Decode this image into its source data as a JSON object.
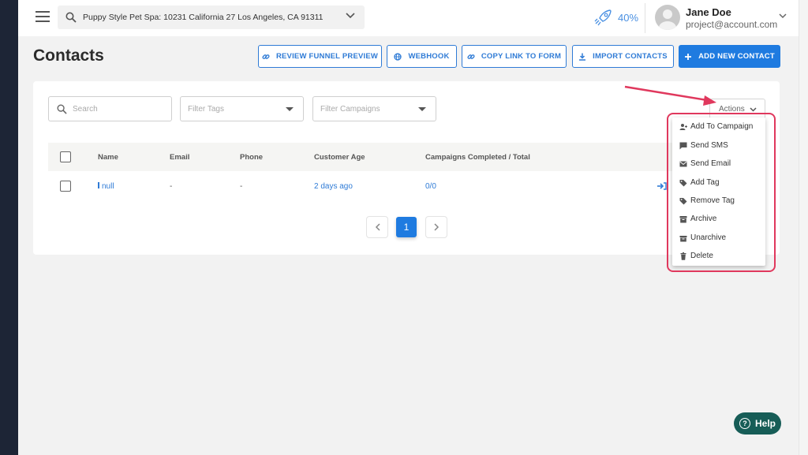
{
  "header": {
    "location": "Puppy Style Pet Spa: 10231 California 27 Los Angeles, CA 91311",
    "progress": "40%",
    "user_name": "Jane Doe",
    "user_email": "project@account.com"
  },
  "page": {
    "title": "Contacts"
  },
  "toolbar": {
    "review_funnel": "REVIEW FUNNEL PREVIEW",
    "webhook": "WEBHOOK",
    "copy_link": "COPY LINK TO FORM",
    "import_contacts": "IMPORT CONTACTS",
    "add_contact": "ADD NEW CONTACT"
  },
  "filters": {
    "search_placeholder": "Search",
    "tags_placeholder": "Filter Tags",
    "campaigns_placeholder": "Filter Campaigns",
    "actions_label": "Actions"
  },
  "table": {
    "columns": [
      "Name",
      "Email",
      "Phone",
      "Customer Age",
      "Campaigns Completed / Total"
    ],
    "rows": [
      {
        "name": "null",
        "email": "-",
        "phone": "-",
        "customer_age": "2 days ago",
        "campaigns": "0/0"
      }
    ]
  },
  "pagination": {
    "current": "1"
  },
  "actions_menu": {
    "items": [
      "Add To Campaign",
      "Send SMS",
      "Send Email",
      "Add Tag",
      "Remove Tag",
      "Archive",
      "Unarchive",
      "Delete"
    ]
  },
  "help": {
    "label": "Help"
  },
  "colors": {
    "primary": "#1f7be0",
    "highlight": "#e0385d",
    "help_bg": "#175d57",
    "sidebar": "#1d2536"
  }
}
